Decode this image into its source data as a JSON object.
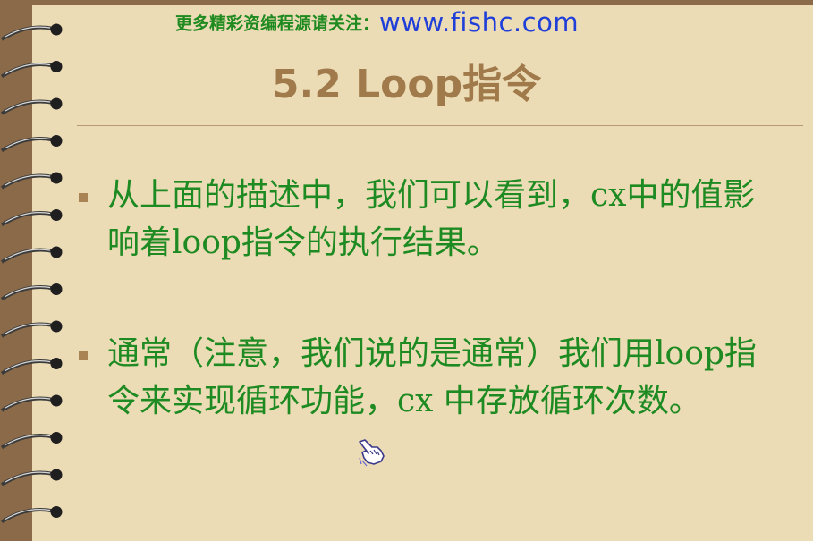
{
  "header": {
    "promo_text": "更多精彩资编程源请关注：",
    "url_text": "www.fishc.com"
  },
  "title": "5.2 Loop指令",
  "bullets": [
    {
      "text": "从上面的描述中，我们可以看到，cx中的值影响着loop指令的执行结果。"
    },
    {
      "text": "通常（注意，我们说的是通常）我们用loop指令来实现循环功能，cx 中存放循环次数。"
    }
  ],
  "colors": {
    "page_background": "#ecdcb6",
    "binding_edge": "#8a6a48",
    "title": "#a07a4a",
    "body_text": "#1e8a22",
    "header_text": "#1f8a1f",
    "url": "#1f3fd8",
    "bullet": "#a98354"
  },
  "icons": {
    "binding": "spiral-binding-rings",
    "pointer": "hand-pointer-cursor"
  }
}
